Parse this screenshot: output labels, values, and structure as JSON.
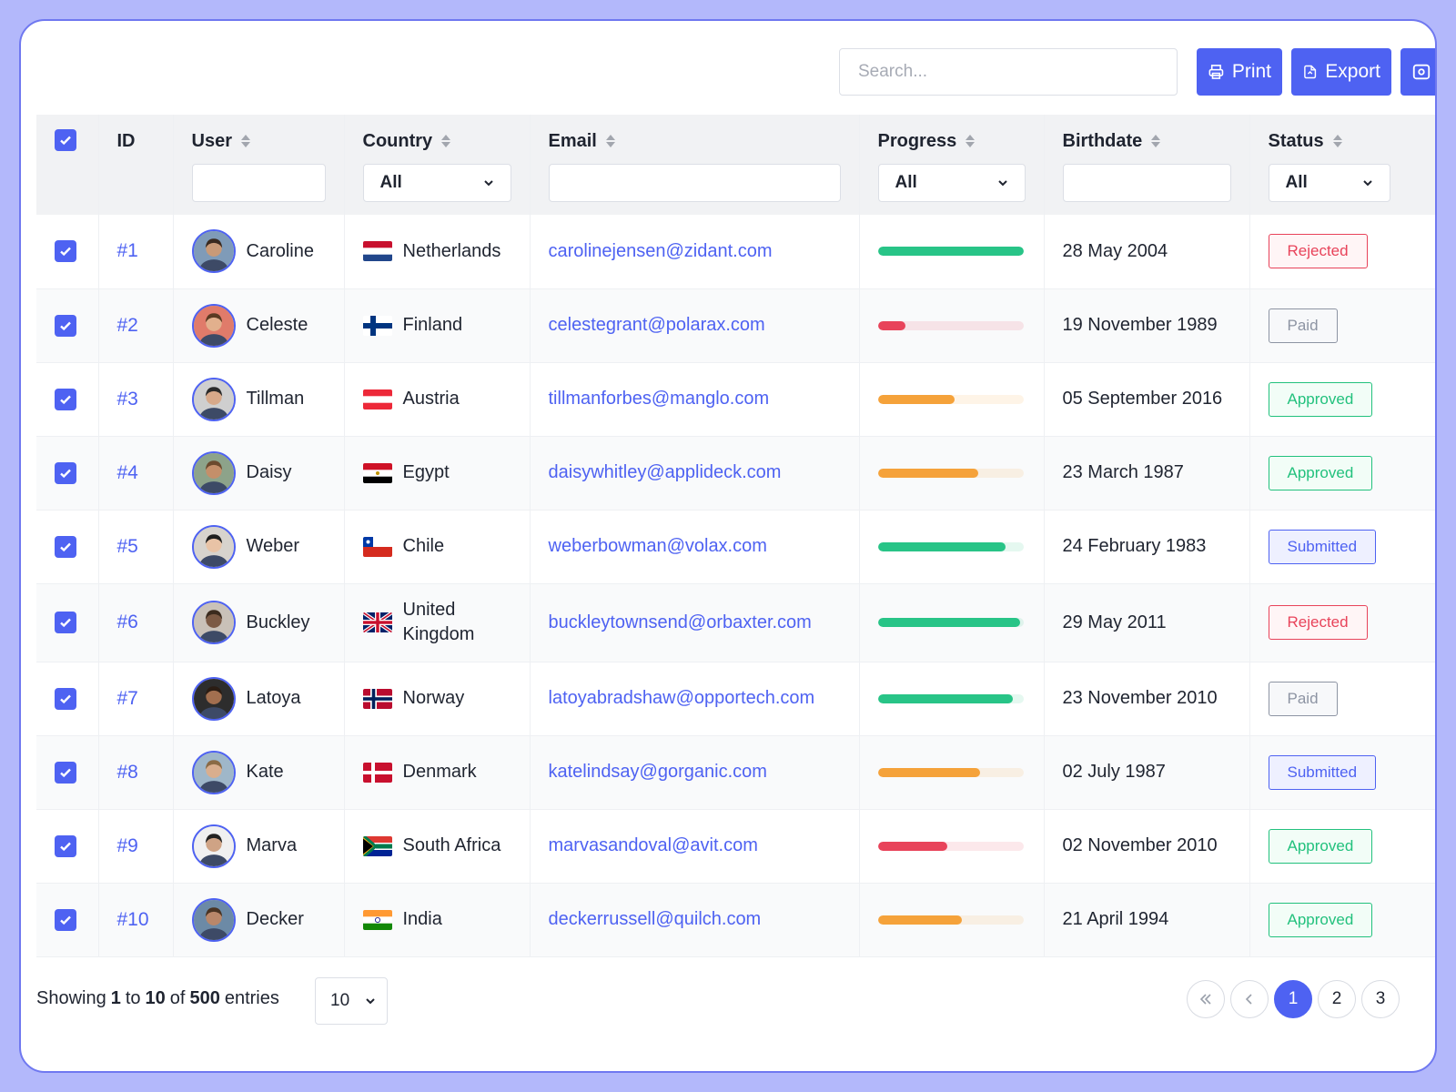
{
  "toolbar": {
    "search_placeholder": "Search...",
    "print_label": "Print",
    "export_label": "Export"
  },
  "columns": {
    "id": "ID",
    "user": "User",
    "country": "Country",
    "email": "Email",
    "progress": "Progress",
    "birthdate": "Birthdate",
    "status": "Status"
  },
  "filters": {
    "country": "All",
    "progress": "All",
    "status": "All"
  },
  "rows": [
    {
      "id": "#1",
      "user": "Caroline",
      "country": "Netherlands",
      "flag": "nl-flag-icon",
      "email": "carolinejensen@zidant.com",
      "progress": 1.0,
      "progress_color": "#28c487",
      "birthdate": "28 May 2004",
      "status": "Rejected"
    },
    {
      "id": "#2",
      "user": "Celeste",
      "country": "Finland",
      "flag": "fi-flag-icon",
      "email": "celestegrant@polarax.com",
      "progress": 0.19,
      "progress_color": "#e8435a",
      "birthdate": "19 November 1989",
      "status": "Paid"
    },
    {
      "id": "#3",
      "user": "Tillman",
      "country": "Austria",
      "flag": "at-flag-icon",
      "email": "tillmanforbes@manglo.com",
      "progress": 0.53,
      "progress_color": "#f5a23a",
      "birthdate": "05 September 2016",
      "status": "Approved"
    },
    {
      "id": "#4",
      "user": "Daisy",
      "country": "Egypt",
      "flag": "eg-flag-icon",
      "email": "daisywhitley@applideck.com",
      "progress": 0.69,
      "progress_color": "#f5a23a",
      "birthdate": "23 March 1987",
      "status": "Approved"
    },
    {
      "id": "#5",
      "user": "Weber",
      "country": "Chile",
      "flag": "cl-flag-icon",
      "email": "weberbowman@volax.com",
      "progress": 0.88,
      "progress_color": "#28c487",
      "birthdate": "24 February 1983",
      "status": "Submitted"
    },
    {
      "id": "#6",
      "user": "Buckley",
      "country": "United Kingdom",
      "flag": "gb-flag-icon",
      "email": "buckleytownsend@orbaxter.com",
      "progress": 0.98,
      "progress_color": "#28c487",
      "birthdate": "29 May 2011",
      "status": "Rejected"
    },
    {
      "id": "#7",
      "user": "Latoya",
      "country": "Norway",
      "flag": "no-flag-icon",
      "email": "latoyabradshaw@opportech.com",
      "progress": 0.93,
      "progress_color": "#28c487",
      "birthdate": "23 November 2010",
      "status": "Paid"
    },
    {
      "id": "#8",
      "user": "Kate",
      "country": "Denmark",
      "flag": "dk-flag-icon",
      "email": "katelindsay@gorganic.com",
      "progress": 0.7,
      "progress_color": "#f5a23a",
      "birthdate": "02 July 1987",
      "status": "Submitted"
    },
    {
      "id": "#9",
      "user": "Marva",
      "country": "South Africa",
      "flag": "za-flag-icon",
      "email": "marvasandoval@avit.com",
      "progress": 0.48,
      "progress_color": "#e8435a",
      "birthdate": "02 November 2010",
      "status": "Approved"
    },
    {
      "id": "#10",
      "user": "Decker",
      "country": "India",
      "flag": "in-flag-icon",
      "email": "deckerrussell@quilch.com",
      "progress": 0.58,
      "progress_color": "#f5a23a",
      "birthdate": "21 April 1994",
      "status": "Approved"
    }
  ],
  "footer": {
    "showing": "Showing",
    "from": "1",
    "to_word": "to",
    "to": "10",
    "of_word": "of",
    "total": "500",
    "entries_word": "entries",
    "page_size": "10",
    "pages": [
      "1",
      "2",
      "3"
    ],
    "active_page": "1"
  },
  "colors": {
    "accent": "#4e62f2",
    "rejected": "#e8435a",
    "approved": "#22c17d",
    "paid": "#8d94a3",
    "warning": "#f5a23a",
    "success": "#28c487"
  }
}
